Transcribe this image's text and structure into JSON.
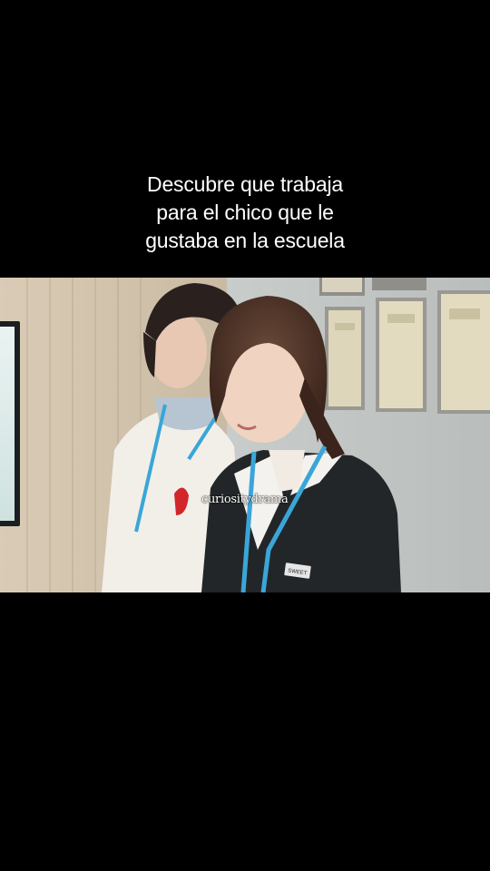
{
  "caption": {
    "lines": [
      "Descubre que trabaja",
      "para el chico que le",
      "gustaba en la escuela"
    ]
  },
  "video": {
    "watermark": "curiositydrama",
    "badge_text": "SWEET"
  },
  "colors": {
    "background": "#000000",
    "caption_text": "#ffffff",
    "lanyard": "#3aa6d8"
  }
}
